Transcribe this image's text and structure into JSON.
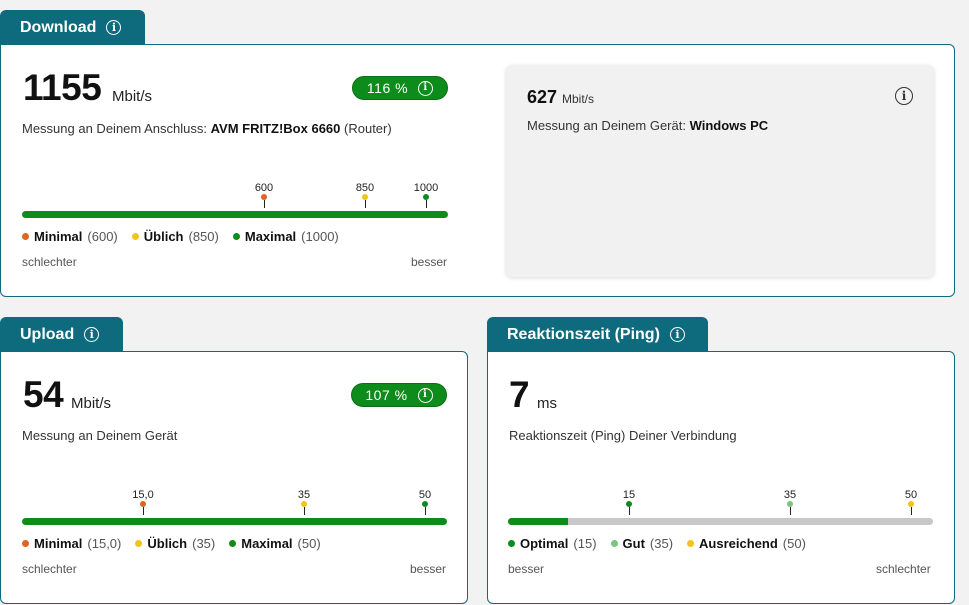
{
  "colors": {
    "accent": "#0d6b7d",
    "green": "#0e8c1b",
    "orange": "#e0641f",
    "yellow": "#f2c417",
    "lightgreen": "#7cc47f",
    "grey": "#c8c8c8"
  },
  "download": {
    "tab": "Download",
    "value": "1155",
    "unit": "Mbit/s",
    "pct": "116 %",
    "desc_prefix": "Messung an Deinem Anschluss:",
    "desc_device": "AVM FRITZ!Box 6660",
    "desc_suffix": "(Router)",
    "markers": [
      "600",
      "850",
      "1000"
    ],
    "legend": [
      {
        "label": "Minimal",
        "value": "(600)"
      },
      {
        "label": "Üblich",
        "value": "(850)"
      },
      {
        "label": "Maximal",
        "value": "(1000)"
      }
    ],
    "left": "schlechter",
    "right": "besser",
    "device": {
      "value": "627",
      "unit": "Mbit/s",
      "desc_prefix": "Messung an Deinem Gerät:",
      "desc_device": "Windows PC"
    }
  },
  "upload": {
    "tab": "Upload",
    "value": "54",
    "unit": "Mbit/s",
    "pct": "107 %",
    "desc": "Messung an Deinem Gerät",
    "markers": [
      "15,0",
      "35",
      "50"
    ],
    "legend": [
      {
        "label": "Minimal",
        "value": "(15,0)"
      },
      {
        "label": "Üblich",
        "value": "(35)"
      },
      {
        "label": "Maximal",
        "value": "(50)"
      }
    ],
    "left": "schlechter",
    "right": "besser"
  },
  "ping": {
    "tab": "Reaktionszeit (Ping)",
    "value": "7",
    "unit": "ms",
    "desc": "Reaktionszeit (Ping) Deiner Verbindung",
    "fill_fraction": 0.14,
    "markers": [
      "15",
      "35",
      "50"
    ],
    "legend": [
      {
        "label": "Optimal",
        "value": "(15)"
      },
      {
        "label": "Gut",
        "value": "(35)"
      },
      {
        "label": "Ausreichend",
        "value": "(50)"
      }
    ],
    "left": "besser",
    "right": "schlechter"
  }
}
